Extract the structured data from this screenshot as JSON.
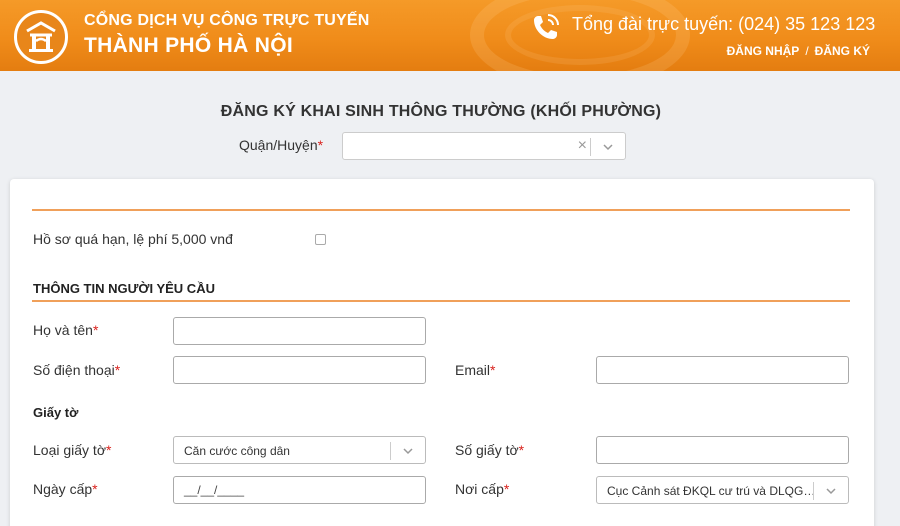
{
  "header": {
    "brand_line1": "CỔNG DỊCH VỤ CÔNG TRỰC TUYẾN",
    "brand_line2": "THÀNH PHỐ HÀ NỘI",
    "hotline": "Tổng đài trực tuyến: (024) 35 123 123",
    "login": "ĐĂNG NHẬP",
    "separator": "/",
    "register": "ĐĂNG KÝ"
  },
  "page": {
    "title": "ĐĂNG KÝ KHAI SINH THÔNG THƯỜNG (KHỐI PHƯỜNG)",
    "district_label": "Quận/Huyện",
    "district_value": "",
    "required_mark": "*"
  },
  "form": {
    "late_fee_label": "Hồ sơ quá hạn, lệ phí 5,000 vnđ",
    "late_fee_checked": false,
    "requester_section": "THÔNG TIN NGƯỜI YÊU CẦU",
    "full_name_label": "Họ và tên",
    "full_name_value": "",
    "phone_label": "Số điện thoại",
    "phone_value": "",
    "email_label": "Email",
    "email_value": "",
    "documents_section": "Giấy tờ",
    "doc_type_label": "Loại giấy tờ",
    "doc_type_value": "Căn cước công dân",
    "doc_number_label": "Số giấy tờ",
    "doc_number_value": "",
    "issue_date_label": "Ngày cấp",
    "issue_date_value": "__/__/____",
    "issued_by_label": "Nơi cấp",
    "issued_by_value": "Cục Cảnh sát ĐKQL cư trú và DLQG v..."
  },
  "colors": {
    "header_orange": "#f08c1a",
    "accent_line": "#f0a05a",
    "required_red": "#d9211c"
  }
}
